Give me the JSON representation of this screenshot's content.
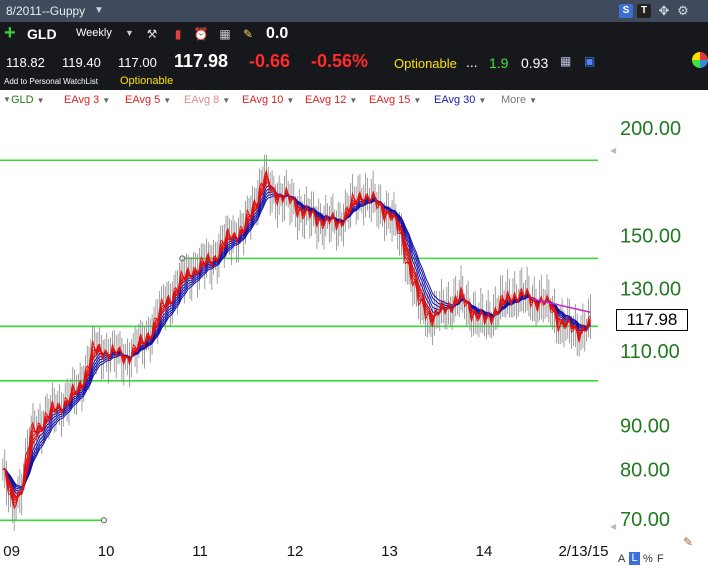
{
  "window": {
    "title": "8/2011--Guppy",
    "dropdown_glyph": "▼",
    "icons": {
      "s": {
        "name": "s-icon",
        "glyph": "S"
      },
      "t": {
        "name": "t-icon",
        "glyph": "T"
      },
      "move": {
        "name": "move-icon",
        "glyph": "✥"
      },
      "gear": {
        "name": "gear-icon",
        "glyph": "⚙"
      }
    }
  },
  "toolbar": {
    "add_glyph": "+",
    "symbol": "GLD",
    "interval": "Weekly",
    "interval_dd": "▼",
    "tools": [
      "⚒",
      "▮",
      "⏰",
      "▦",
      "✎"
    ],
    "value_display": "0.0"
  },
  "quote": {
    "open": "118.82",
    "high": "119.40",
    "low": "117.00",
    "last": "117.98",
    "change": "-0.66",
    "percent": "-0.56%",
    "optionable": "Optionable",
    "dots": "...",
    "value1": "1.9",
    "value2": "0.93",
    "watchlist_link": "Add to Personal WatchList",
    "optionable_link": "Optionable",
    "icon1": "▦",
    "icon2": "▣"
  },
  "studies": {
    "gear_glyph": "▼",
    "items": [
      {
        "id": "gld",
        "label": "GLD"
      },
      {
        "id": "e3",
        "label": "EAvg 3"
      },
      {
        "id": "e5",
        "label": "EAvg 5"
      },
      {
        "id": "e8",
        "label": "EAvg 8"
      },
      {
        "id": "e10",
        "label": "EAvg 10"
      },
      {
        "id": "e12",
        "label": "EAvg 12"
      },
      {
        "id": "e15",
        "label": "EAvg 15"
      },
      {
        "id": "e30",
        "label": "EAvg 30"
      },
      {
        "id": "more",
        "label": "More"
      }
    ],
    "arrow": "▼"
  },
  "chart_data": {
    "type": "line",
    "symbol": "GLD",
    "interval": "Weekly",
    "y_scale": "log",
    "ylim": [
      68,
      210
    ],
    "x_tick_labels": [
      "09",
      "10",
      "11",
      "12",
      "13",
      "14",
      "2/13/15"
    ],
    "x_ticks": [
      2009.0,
      2010.0,
      2011.0,
      2012.0,
      2013.0,
      2014.0,
      2015.12
    ],
    "xlim": [
      2008.87,
      2015.2
    ],
    "y_tick_values": [
      200,
      150,
      130,
      110,
      90,
      80,
      70
    ],
    "y_tick_labels": [
      "200.00",
      "150.00",
      "130.00",
      "110.00",
      "90.00",
      "80.00",
      "70.00"
    ],
    "last_price_label": "117.98",
    "colors": {
      "price_bars": "#888888",
      "short_emas": "#dd1111",
      "long_emas": "#1111aa",
      "horizontal_lines": "#33dd33",
      "trend_line": "#cc22cc"
    },
    "horizontal_lines": [
      {
        "y": 183.5,
        "x_start": 2008.87,
        "x_end": 2015.2
      },
      {
        "y": 141.0,
        "x_start": 2010.8,
        "x_end": 2015.2
      },
      {
        "y": 117.5,
        "x_start": 2008.87,
        "x_end": 2015.2
      },
      {
        "y": 101.5,
        "x_start": 2008.87,
        "x_end": 2015.2
      },
      {
        "y": 69.8,
        "x_start": 2008.87,
        "x_end": 2009.97
      }
    ],
    "trend_line": {
      "x": [
        2014.5,
        2015.12
      ],
      "y": [
        126.5,
        122.0
      ]
    },
    "close_path": {
      "x": [
        2008.9,
        2009.0,
        2009.1,
        2009.2,
        2009.35,
        2009.5,
        2009.7,
        2009.85,
        2010.0,
        2010.2,
        2010.4,
        2010.6,
        2010.75,
        2010.9,
        2011.0,
        2011.15,
        2011.3,
        2011.45,
        2011.6,
        2011.67,
        2011.75,
        2011.9,
        2012.0,
        2012.15,
        2012.3,
        2012.45,
        2012.6,
        2012.7,
        2012.8,
        2012.9,
        2013.0,
        2013.1,
        2013.2,
        2013.3,
        2013.45,
        2013.6,
        2013.75,
        2013.9,
        2014.0,
        2014.15,
        2014.3,
        2014.45,
        2014.6,
        2014.7,
        2014.8,
        2014.9,
        2015.0,
        2015.12
      ],
      "y": [
        80,
        72,
        77,
        88,
        92,
        95,
        99,
        110,
        110,
        108,
        113,
        124,
        131,
        137,
        138,
        142,
        150,
        152,
        168,
        175,
        168,
        166,
        162,
        158,
        156,
        155,
        163,
        168,
        165,
        161,
        159,
        150,
        138,
        125,
        120,
        124,
        127,
        121,
        119,
        124,
        128,
        127,
        125,
        124,
        118,
        117,
        116,
        118
      ]
    },
    "short_ema_offsets": [
      0,
      1.5,
      -1.5,
      2.5,
      -2.5,
      3.5
    ],
    "long_ema_offsets": [
      0,
      2,
      4,
      6,
      8,
      10
    ]
  },
  "footer": {
    "a": "A",
    "l": "L",
    "pct": "%",
    "f": "F",
    "pencil": "✎",
    "scroll_up": "◀",
    "scroll_down": "◀"
  }
}
